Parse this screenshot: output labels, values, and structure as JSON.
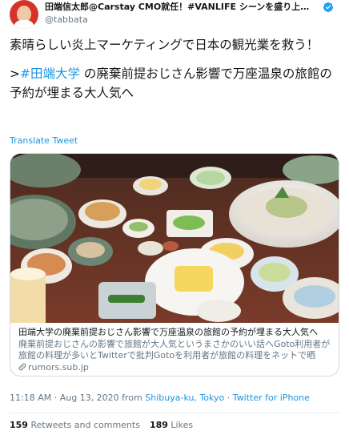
{
  "header": {
    "display_name": "田端信太郎@Carstay CMO就任！#VANLIFE シーンを盛り上げ…",
    "handle": "@tabbata",
    "verified_icon": "verified-badge-icon",
    "avatar_color": "#d9322b"
  },
  "tweet": {
    "line1": "素晴らしい炎上マーケティングで日本の観光業を救う！",
    "arrow": ">",
    "hashtag": "#田端大学",
    "line2_rest": " の廃棄前提おじさん影響で万座温泉の旅館の予約が埋まる大人気へ",
    "translate": "Translate Tweet"
  },
  "card": {
    "title": "田端大学の廃棄前提おじさん影響で万座温泉の旅館の予約が埋まる大人気へ",
    "description": "廃棄前提おじさんの影響で旅館が大人気というまさかのいい話へGoto利用者が旅館の料理が多いとTwitterで批判Gotoを利用者が旅館の料理をネットで晒し…",
    "domain": "rumors.sub.jp",
    "link_icon": "link-icon",
    "image_alt": "旅館の料理"
  },
  "meta": {
    "time": "11:18 AM",
    "sep1": " · ",
    "date": "Aug 13, 2020",
    "from": " from ",
    "location": "Shibuya-ku, Tokyo",
    "sep2": " · ",
    "client": "Twitter for iPhone"
  },
  "stats": {
    "retweets_count": "159",
    "retweets_label": " Retweets and comments",
    "likes_count": "189",
    "likes_label": " Likes"
  },
  "colors": {
    "link": "#1b95e0",
    "secondary": "#657786",
    "text": "#14171a"
  }
}
